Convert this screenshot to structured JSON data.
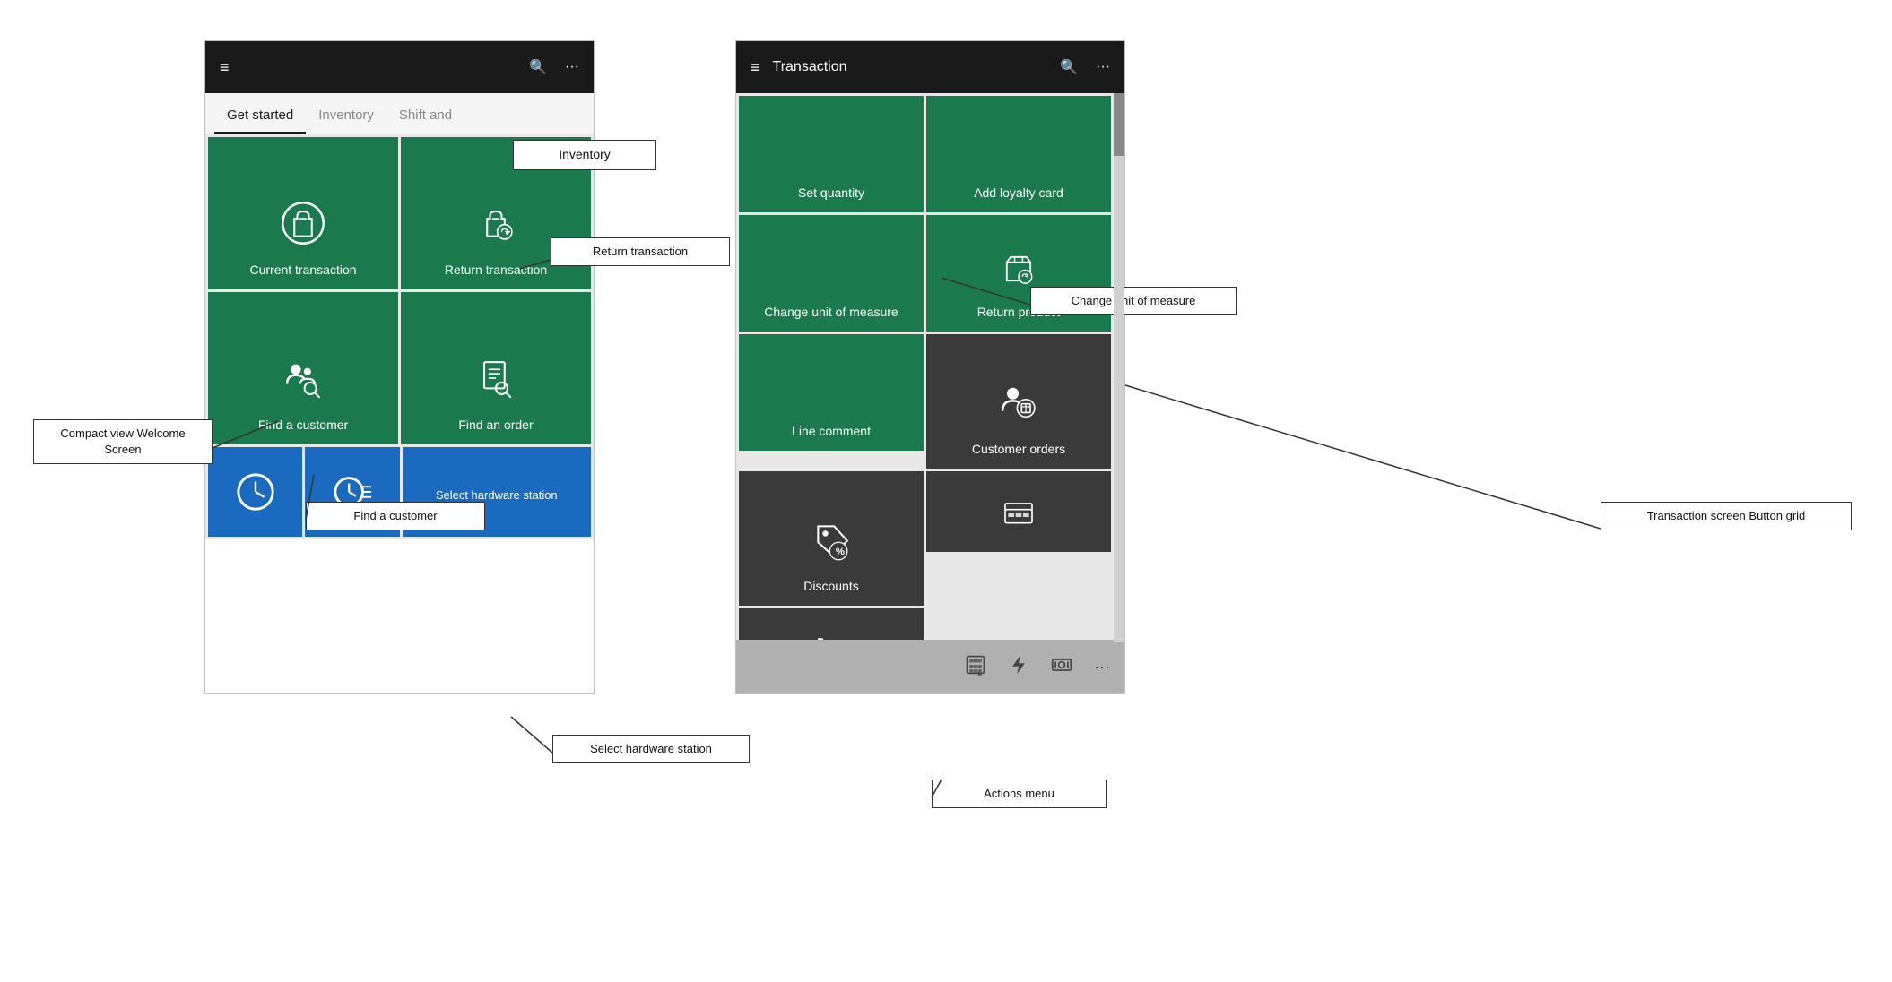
{
  "left_phone": {
    "header": {
      "title": "",
      "hamburger": "≡",
      "search": "🔍",
      "dots": "···"
    },
    "tabs": [
      {
        "label": "Get started",
        "active": true
      },
      {
        "label": "Inventory",
        "active": false
      },
      {
        "label": "Shift and",
        "active": false,
        "partial": true
      }
    ],
    "tiles": [
      {
        "id": "current-transaction",
        "label": "Current transaction",
        "type": "green"
      },
      {
        "id": "return-transaction",
        "label": "Return transaction",
        "type": "green"
      },
      {
        "id": "find-customer",
        "label": "Find a customer",
        "type": "green"
      },
      {
        "id": "find-order",
        "label": "Find an order",
        "type": "green"
      }
    ],
    "clock_tiles": [
      {
        "id": "clock-in",
        "label": "",
        "type": "blue"
      },
      {
        "id": "clock-out",
        "label": "",
        "type": "blue"
      },
      {
        "id": "select-hardware",
        "label": "Select hardware station",
        "type": "blue"
      }
    ]
  },
  "right_phone": {
    "header": {
      "title": "Transaction",
      "hamburger": "≡",
      "search": "🔍",
      "dots": "···"
    },
    "tiles": [
      {
        "id": "set-quantity",
        "label": "Set quantity",
        "type": "green"
      },
      {
        "id": "add-loyalty",
        "label": "Add loyalty card",
        "type": "green"
      },
      {
        "id": "change-uom",
        "label": "Change unit of measure",
        "type": "green"
      },
      {
        "id": "return-product",
        "label": "Return product",
        "type": "green"
      },
      {
        "id": "line-comment",
        "label": "Line comment",
        "type": "green"
      },
      {
        "id": "customer-orders",
        "label": "Customer orders",
        "type": "dark"
      },
      {
        "id": "discounts",
        "label": "Discounts",
        "type": "dark"
      },
      {
        "id": "actions-1",
        "label": "",
        "type": "dark"
      },
      {
        "id": "actions-2",
        "label": "",
        "type": "dark"
      }
    ],
    "toolbar": {
      "calculator": "calculator",
      "lightning": "lightning",
      "cash": "cash",
      "dots": "···"
    }
  },
  "annotations": {
    "compact_view": "Compact view\nWelcome Screen",
    "return_transaction": "Return transaction",
    "find_customer": "Find a customer",
    "change_uom": "Change unit of measure",
    "select_hardware": "Select hardware station",
    "transaction_button_grid": "Transaction screen\nButton grid",
    "actions_menu": "Actions menu",
    "inventory_tab": "Inventory"
  }
}
